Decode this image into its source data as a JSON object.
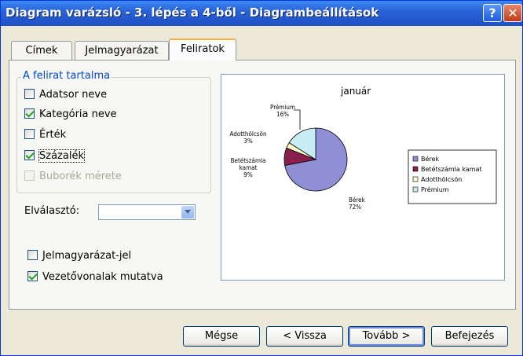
{
  "window": {
    "title": "Diagram varázsló - 3. lépés a 4-ből - Diagrambeállítások",
    "help": "?",
    "close": "✕"
  },
  "tabs": [
    {
      "label": "Címek"
    },
    {
      "label": "Jelmagyarázat"
    },
    {
      "label": "Feliratok",
      "active": true
    }
  ],
  "group": {
    "legend": "A felirat tartalma",
    "options": [
      {
        "label": "Adatsor neve",
        "checked": false
      },
      {
        "label": "Kategória neve",
        "checked": true
      },
      {
        "label": "Érték",
        "checked": false
      },
      {
        "label": "Százalék",
        "checked": true
      },
      {
        "label": "Buborék mérete",
        "checked": false,
        "disabled": true
      }
    ]
  },
  "separator": {
    "label": "Elválasztó:",
    "value": ""
  },
  "legend_key": {
    "label": "Jelmagyarázat-jel",
    "checked": false
  },
  "leader_lines": {
    "label": "Vezetővonalak mutatva",
    "checked": true
  },
  "chart_data": {
    "type": "pie",
    "title": "január",
    "categories": [
      "Bérek",
      "Betétszámla kamat",
      "Adotthölcsön",
      "Prémium"
    ],
    "values": [
      72,
      9,
      3,
      16
    ],
    "data_labels": [
      {
        "name": "Bérek",
        "pct": "72%"
      },
      {
        "name": "Betétszámla kamat",
        "name_lines": [
          "Betétszámla",
          "kamat"
        ],
        "pct": "9%"
      },
      {
        "name": "Adotthölcsön",
        "pct": "3%"
      },
      {
        "name": "Prémium",
        "pct": "16%"
      }
    ],
    "colors": [
      "#8f8fd6",
      "#8a1f4e",
      "#fffccc",
      "#c8ecf4"
    ],
    "legend_position": "right"
  },
  "buttons": {
    "cancel": "Mégse",
    "back": "< Vissza",
    "next": "Tovább >",
    "finish": "Befejezés"
  }
}
